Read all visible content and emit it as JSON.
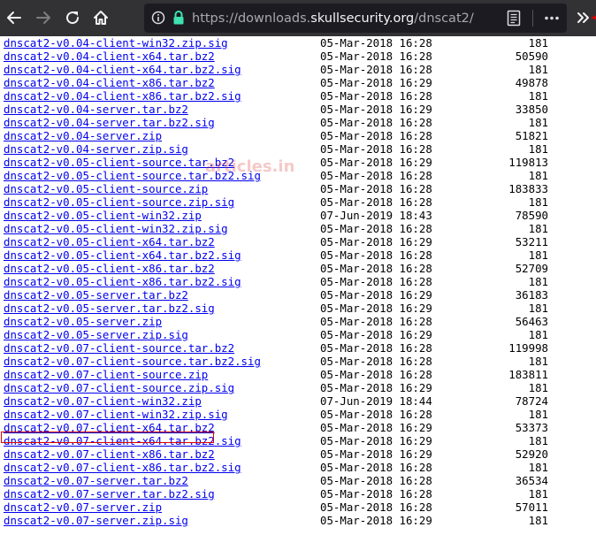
{
  "browser": {
    "url_prefix": "https://downloads.",
    "url_domain": "skullsecurity.org",
    "url_path": "/dnscat2/"
  },
  "watermark": "articles.in",
  "colors": {
    "toolbar_bg": "#323234",
    "urlbar_bg": "#1c1b22",
    "link": "#0000ee",
    "lock_green": "#3fe1b0",
    "annotation_red": "#e00000"
  },
  "files": [
    {
      "name": "dnscat2-v0.04-client-win32.zip.sig",
      "date": "05-Mar-2018 16:28",
      "size": "181"
    },
    {
      "name": "dnscat2-v0.04-client-x64.tar.bz2",
      "date": "05-Mar-2018 16:28",
      "size": "50590"
    },
    {
      "name": "dnscat2-v0.04-client-x64.tar.bz2.sig",
      "date": "05-Mar-2018 16:28",
      "size": "181"
    },
    {
      "name": "dnscat2-v0.04-client-x86.tar.bz2",
      "date": "05-Mar-2018 16:29",
      "size": "49878"
    },
    {
      "name": "dnscat2-v0.04-client-x86.tar.bz2.sig",
      "date": "05-Mar-2018 16:28",
      "size": "181"
    },
    {
      "name": "dnscat2-v0.04-server.tar.bz2",
      "date": "05-Mar-2018 16:29",
      "size": "33850"
    },
    {
      "name": "dnscat2-v0.04-server.tar.bz2.sig",
      "date": "05-Mar-2018 16:28",
      "size": "181"
    },
    {
      "name": "dnscat2-v0.04-server.zip",
      "date": "05-Mar-2018 16:28",
      "size": "51821"
    },
    {
      "name": "dnscat2-v0.04-server.zip.sig",
      "date": "05-Mar-2018 16:28",
      "size": "181"
    },
    {
      "name": "dnscat2-v0.05-client-source.tar.bz2",
      "date": "05-Mar-2018 16:29",
      "size": "119813"
    },
    {
      "name": "dnscat2-v0.05-client-source.tar.bz2.sig",
      "date": "05-Mar-2018 16:28",
      "size": "181"
    },
    {
      "name": "dnscat2-v0.05-client-source.zip",
      "date": "05-Mar-2018 16:28",
      "size": "183833"
    },
    {
      "name": "dnscat2-v0.05-client-source.zip.sig",
      "date": "05-Mar-2018 16:28",
      "size": "181"
    },
    {
      "name": "dnscat2-v0.05-client-win32.zip",
      "date": "07-Jun-2019 18:43",
      "size": "78590"
    },
    {
      "name": "dnscat2-v0.05-client-win32.zip.sig",
      "date": "05-Mar-2018 16:28",
      "size": "181"
    },
    {
      "name": "dnscat2-v0.05-client-x64.tar.bz2",
      "date": "05-Mar-2018 16:29",
      "size": "53211"
    },
    {
      "name": "dnscat2-v0.05-client-x64.tar.bz2.sig",
      "date": "05-Mar-2018 16:28",
      "size": "181"
    },
    {
      "name": "dnscat2-v0.05-client-x86.tar.bz2",
      "date": "05-Mar-2018 16:28",
      "size": "52709"
    },
    {
      "name": "dnscat2-v0.05-client-x86.tar.bz2.sig",
      "date": "05-Mar-2018 16:28",
      "size": "181"
    },
    {
      "name": "dnscat2-v0.05-server.tar.bz2",
      "date": "05-Mar-2018 16:29",
      "size": "36183"
    },
    {
      "name": "dnscat2-v0.05-server.tar.bz2.sig",
      "date": "05-Mar-2018 16:29",
      "size": "181"
    },
    {
      "name": "dnscat2-v0.05-server.zip",
      "date": "05-Mar-2018 16:28",
      "size": "56463"
    },
    {
      "name": "dnscat2-v0.05-server.zip.sig",
      "date": "05-Mar-2018 16:29",
      "size": "181"
    },
    {
      "name": "dnscat2-v0.07-client-source.tar.bz2",
      "date": "05-Mar-2018 16:28",
      "size": "119998"
    },
    {
      "name": "dnscat2-v0.07-client-source.tar.bz2.sig",
      "date": "05-Mar-2018 16:28",
      "size": "181"
    },
    {
      "name": "dnscat2-v0.07-client-source.zip",
      "date": "05-Mar-2018 16:28",
      "size": "183811"
    },
    {
      "name": "dnscat2-v0.07-client-source.zip.sig",
      "date": "05-Mar-2018 16:29",
      "size": "181"
    },
    {
      "name": "dnscat2-v0.07-client-win32.zip",
      "date": "07-Jun-2019 18:44",
      "size": "78724"
    },
    {
      "name": "dnscat2-v0.07-client-win32.zip.sig",
      "date": "05-Mar-2018 16:28",
      "size": "181"
    },
    {
      "name": "dnscat2-v0.07-client-x64.tar.bz2",
      "date": "05-Mar-2018 16:29",
      "size": "53373"
    },
    {
      "name": "dnscat2-v0.07-client-x64.tar.bz2.sig",
      "date": "05-Mar-2018 16:29",
      "size": "181"
    },
    {
      "name": "dnscat2-v0.07-client-x86.tar.bz2",
      "date": "05-Mar-2018 16:29",
      "size": "52920"
    },
    {
      "name": "dnscat2-v0.07-client-x86.tar.bz2.sig",
      "date": "05-Mar-2018 16:28",
      "size": "181"
    },
    {
      "name": "dnscat2-v0.07-server.tar.bz2",
      "date": "05-Mar-2018 16:28",
      "size": "36534"
    },
    {
      "name": "dnscat2-v0.07-server.tar.bz2.sig",
      "date": "05-Mar-2018 16:28",
      "size": "181"
    },
    {
      "name": "dnscat2-v0.07-server.zip",
      "date": "05-Mar-2018 16:28",
      "size": "57011"
    },
    {
      "name": "dnscat2-v0.07-server.zip.sig",
      "date": "05-Mar-2018 16:29",
      "size": "181"
    }
  ]
}
